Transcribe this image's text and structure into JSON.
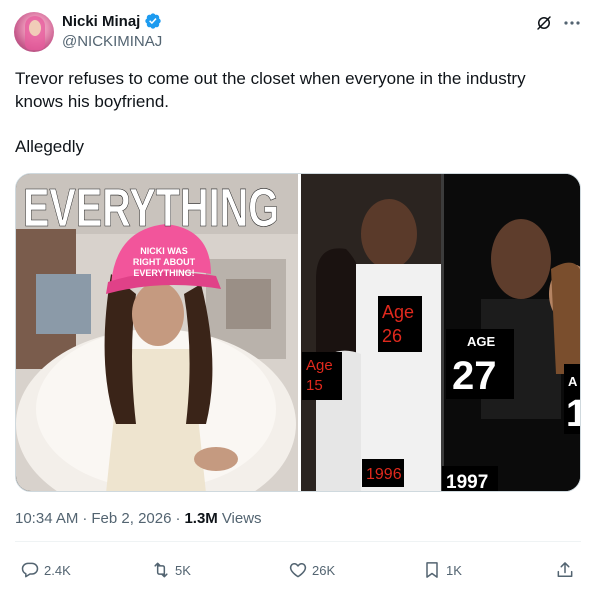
{
  "author": {
    "display_name": "Nicki Minaj",
    "handle": "@NICKIMINAJ",
    "verified": true
  },
  "tweet": {
    "text_line1": "Trevor refuses to come out the closet when everyone in the industry knows his boyfriend.",
    "text_line2": "Allegedly"
  },
  "media": {
    "left_image": {
      "headline": "EVERYTHING",
      "hat_text_1": "NICKI WAS",
      "hat_text_2": "RIGHT ABOUT",
      "hat_text_3": "EVERYTHING!"
    },
    "right_image": {
      "label_age_15_a": "Age",
      "label_age_15_b": "15",
      "label_age_26_a": "Age",
      "label_age_26_b": "26",
      "label_age_27_a": "AGE",
      "label_age_27_b": "27",
      "label_partial_a": "A",
      "label_partial_b": "1",
      "year_1996": "1996",
      "year_1997": "1997"
    }
  },
  "meta": {
    "time": "10:34 AM",
    "separator1": "·",
    "date": "Feb 2, 2026",
    "separator2": "·",
    "views_count": "1.3M",
    "views_label": "Views"
  },
  "actions": {
    "replies": "2.4K",
    "reposts": "5K",
    "likes": "26K",
    "bookmarks": "1K"
  },
  "colors": {
    "verified_badge": "#1d9bf0",
    "hat_pink": "#f2559b",
    "label_red": "#e0291d"
  }
}
